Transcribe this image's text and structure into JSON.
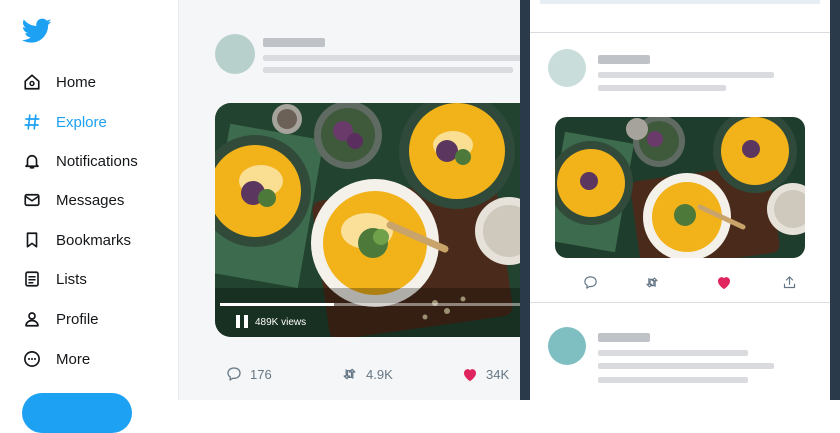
{
  "sidebar": {
    "items": [
      {
        "label": "Home",
        "icon": "home-icon"
      },
      {
        "label": "Explore",
        "icon": "hashtag-icon",
        "active": true
      },
      {
        "label": "Notifications",
        "icon": "bell-icon"
      },
      {
        "label": "Messages",
        "icon": "envelope-icon"
      },
      {
        "label": "Bookmarks",
        "icon": "bookmark-icon"
      },
      {
        "label": "Lists",
        "icon": "list-icon"
      },
      {
        "label": "Profile",
        "icon": "person-icon"
      },
      {
        "label": "More",
        "icon": "more-icon"
      }
    ]
  },
  "tweet": {
    "video": {
      "views": "489K views",
      "progress": 0.38
    },
    "actions": {
      "replies": "176",
      "retweets": "4.9K",
      "likes": "34K"
    }
  },
  "colors": {
    "accent": "#1da1f2",
    "like": "#e0245e",
    "text": "#14171a",
    "muted": "#657786",
    "placeholder": "#d9dbde"
  }
}
